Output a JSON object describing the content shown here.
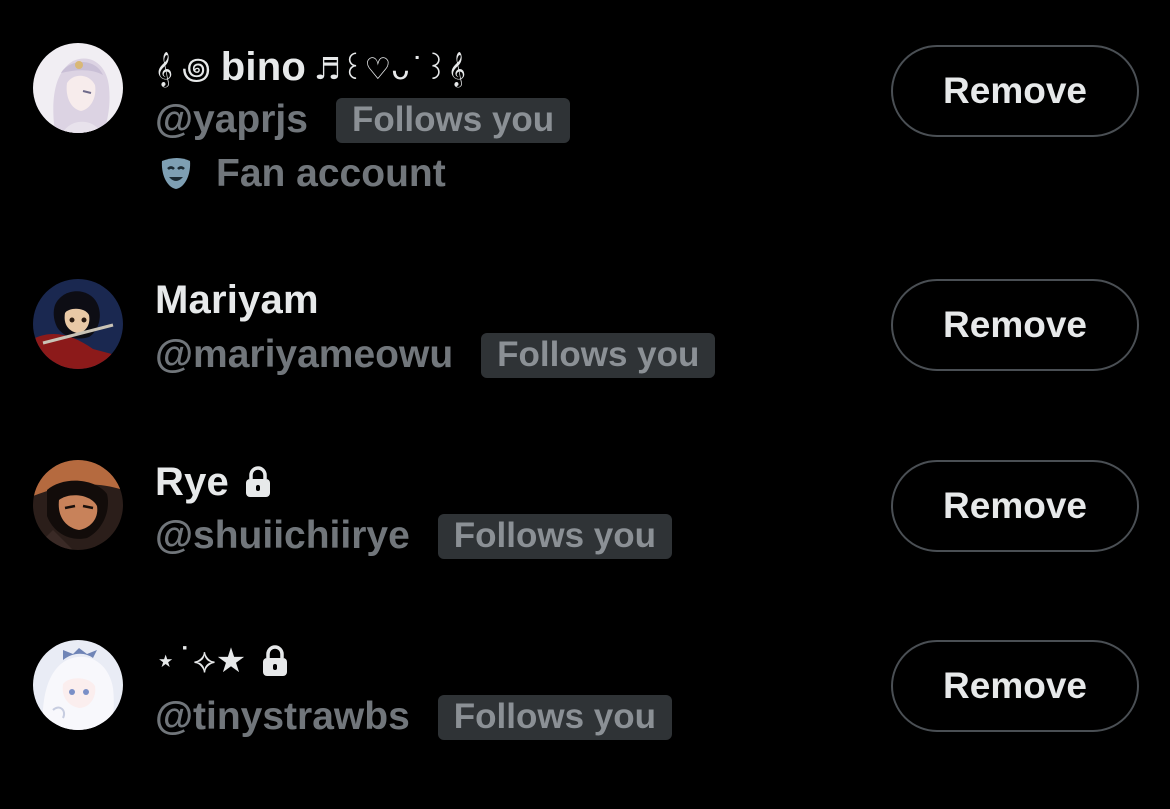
{
  "followers": [
    {
      "display_name": "bino",
      "name_prefix": "𝄞 ꩜",
      "name_suffix": "♬꒰♡ᴗ˙꒱𝄞",
      "handle": "@yaprjs",
      "follows_badge": "Follows you",
      "bio": "Fan account",
      "bio_icon": "theater-mask-icon",
      "protected": false,
      "remove_label": "Remove"
    },
    {
      "display_name": "Mariyam",
      "handle": "@mariyameowu",
      "follows_badge": "Follows you",
      "protected": false,
      "remove_label": "Remove"
    },
    {
      "display_name": "Rye",
      "handle": "@shuiichiirye",
      "follows_badge": "Follows you",
      "protected": true,
      "remove_label": "Remove"
    },
    {
      "display_name": "⋆˙⟡★",
      "handle": "@tinystrawbs",
      "follows_badge": "Follows you",
      "protected": true,
      "remove_label": "Remove"
    }
  ],
  "colors": {
    "background": "#000000",
    "primary_text": "#e7e9ea",
    "secondary_text": "#71767b",
    "badge_background": "#2f3336",
    "button_border": "#4a4f54"
  }
}
